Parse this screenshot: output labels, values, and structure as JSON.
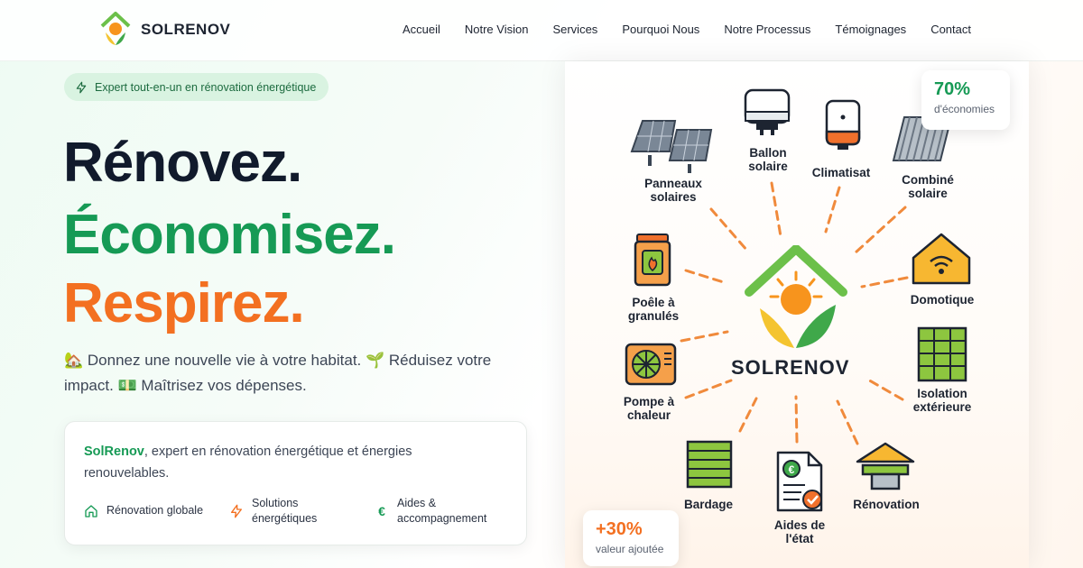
{
  "brand": {
    "name": "SOLRENOV"
  },
  "nav": {
    "items": [
      "Accueil",
      "Notre Vision",
      "Services",
      "Pourquoi Nous",
      "Notre Processus",
      "Témoignages",
      "Contact"
    ]
  },
  "hero": {
    "badge": "Expert tout-en-un en rénovation énergétique",
    "line1": "Rénovez.",
    "line2": "Économisez.",
    "line3": "Respirez.",
    "description": "🏡 Donnez une nouvelle vie à votre habitat. 🌱 Réduisez votre impact. 💵 Maîtrisez vos dépenses."
  },
  "card": {
    "brand": "SolRenov",
    "text": ", expert en rénovation énergétique et énergies renouvelables.",
    "features": [
      {
        "icon": "home-icon",
        "label": "Rénovation globale"
      },
      {
        "icon": "lightning-icon",
        "label": "Solutions énergétiques"
      },
      {
        "icon": "euro-icon",
        "label": "Aides & accompagnement"
      }
    ]
  },
  "diagram": {
    "center": "SOLRENOV",
    "services": {
      "panneaux": "Panneaux solaires",
      "ballon": "Ballon solaire",
      "climatisat": "Climatisat",
      "combine": "Combiné solaire",
      "domotique": "Domotique",
      "poele": "Poêle à granulés",
      "pompe": "Pompe à chaleur",
      "isolation": "Isolation extérieure",
      "bardage": "Bardage",
      "aides": "Aides de l'état",
      "renovation": "Rénovation"
    }
  },
  "stats": {
    "top": {
      "value": "70%",
      "label": "d'économies"
    },
    "bottom": {
      "value": "+30%",
      "label": "valeur ajoutée"
    }
  },
  "colors": {
    "green": "#169a55",
    "orange": "#f37021",
    "dark": "#111a2c"
  }
}
